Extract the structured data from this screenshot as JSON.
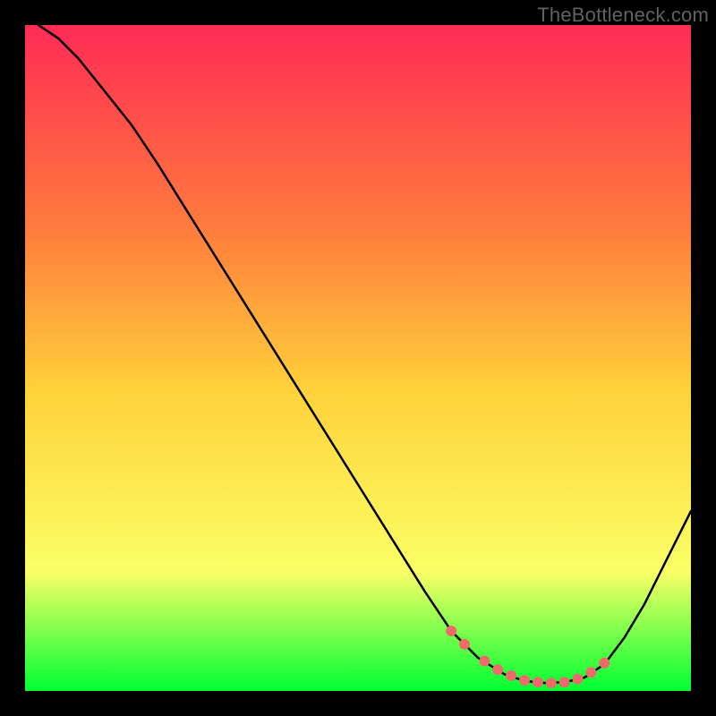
{
  "watermark": "TheBottleneck.com",
  "colors": {
    "gradient_top": "#ff2b55",
    "gradient_mid_upper": "#ff7a3d",
    "gradient_mid": "#ffd23a",
    "gradient_mid_lower": "#fbff66",
    "gradient_bottom": "#00ff33",
    "curve": "#000000",
    "dots": "#ef6a6a",
    "frame": "#000000"
  },
  "chart_data": {
    "type": "line",
    "title": "",
    "xlabel": "",
    "ylabel": "",
    "xlim": [
      0,
      100
    ],
    "ylim": [
      0,
      100
    ],
    "series": [
      {
        "name": "curve",
        "x": [
          2,
          5,
          8,
          12,
          16,
          20,
          25,
          30,
          35,
          40,
          45,
          50,
          55,
          60,
          64,
          68,
          72,
          75,
          78,
          81,
          84,
          87,
          90,
          93,
          96,
          100
        ],
        "y": [
          100,
          98,
          95,
          90,
          85,
          79,
          71,
          63,
          55,
          47,
          39,
          31,
          23,
          15,
          9,
          5,
          2.5,
          1.5,
          1.2,
          1.3,
          2,
          4,
          8,
          13,
          19,
          27
        ]
      }
    ],
    "dots": {
      "name": "highlight",
      "x": [
        64,
        66,
        69,
        71,
        73,
        75,
        77,
        79,
        81,
        83,
        85,
        87
      ],
      "y": [
        9,
        7,
        4.5,
        3.2,
        2.3,
        1.6,
        1.3,
        1.2,
        1.3,
        1.8,
        2.8,
        4.2
      ]
    }
  }
}
